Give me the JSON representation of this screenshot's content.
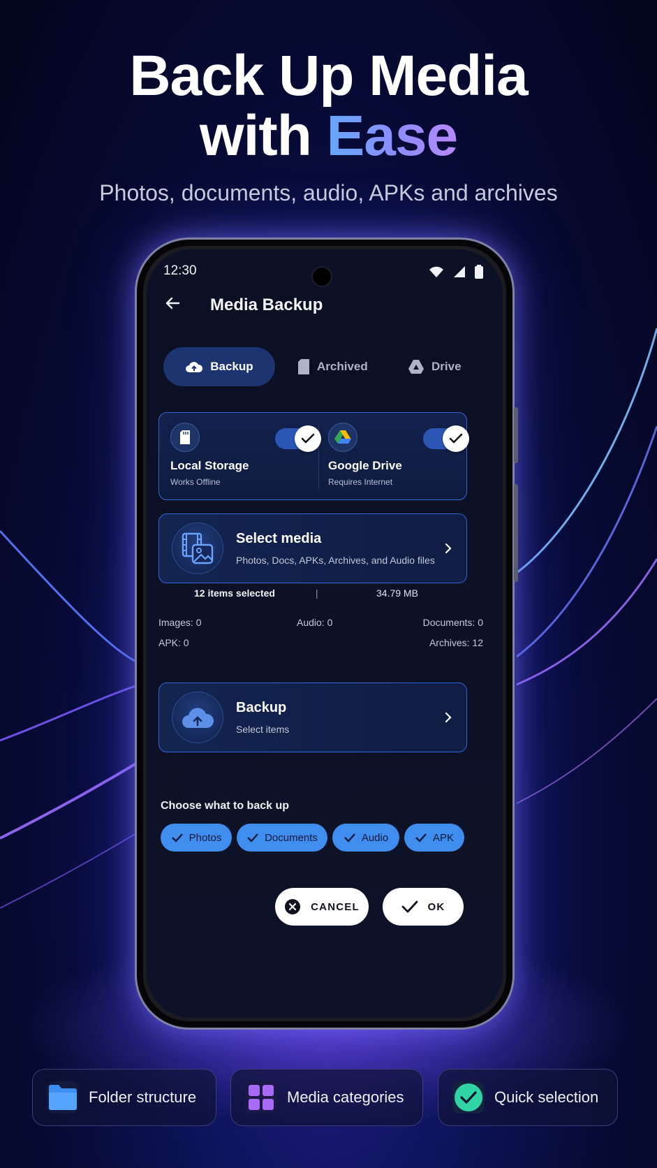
{
  "hero": {
    "title_line1": "Back Up Media",
    "title_line2_plain": "with ",
    "title_line2_accent": "Ease",
    "subtitle": "Photos, documents, audio, APKs and archives"
  },
  "status_bar": {
    "time": "12:30"
  },
  "topbar": {
    "title": "Media Backup"
  },
  "tabs": [
    {
      "label": "Backup",
      "icon": "cloud-icon",
      "active": true
    },
    {
      "label": "Archived",
      "icon": "sd-card-icon",
      "active": false
    },
    {
      "label": "Drive",
      "icon": "drive-icon",
      "active": false
    }
  ],
  "storage": {
    "local": {
      "title": "Local Storage",
      "subtitle": "Works Offline",
      "enabled": true
    },
    "drive": {
      "title": "Google Drive",
      "subtitle": "Requires Internet",
      "enabled": true
    }
  },
  "select_media": {
    "title": "Select media",
    "subtitle": "Photos, Docs, APKs, Archives, and Audio files"
  },
  "summary": {
    "selected": "12 items selected",
    "separator": "|",
    "size": "34.79 MB"
  },
  "counts": {
    "images": "Images: 0",
    "audio": "Audio: 0",
    "documents": "Documents: 0",
    "apk": "APK: 0",
    "archives": "Archives: 12"
  },
  "backup_card": {
    "title": "Backup",
    "subtitle": "Select items"
  },
  "choose": {
    "label": "Choose what to back up",
    "chips": [
      "Photos",
      "Documents",
      "Audio",
      "APK"
    ]
  },
  "buttons": {
    "cancel": "CANCEL",
    "ok": "OK"
  },
  "features": [
    "Folder structure",
    "Media categories",
    "Quick selection"
  ],
  "colors": {
    "accent": "#3f8dee",
    "card_border": "#3266d6",
    "active_tab": "#1c3570",
    "check_green": "#2fd5a5"
  }
}
